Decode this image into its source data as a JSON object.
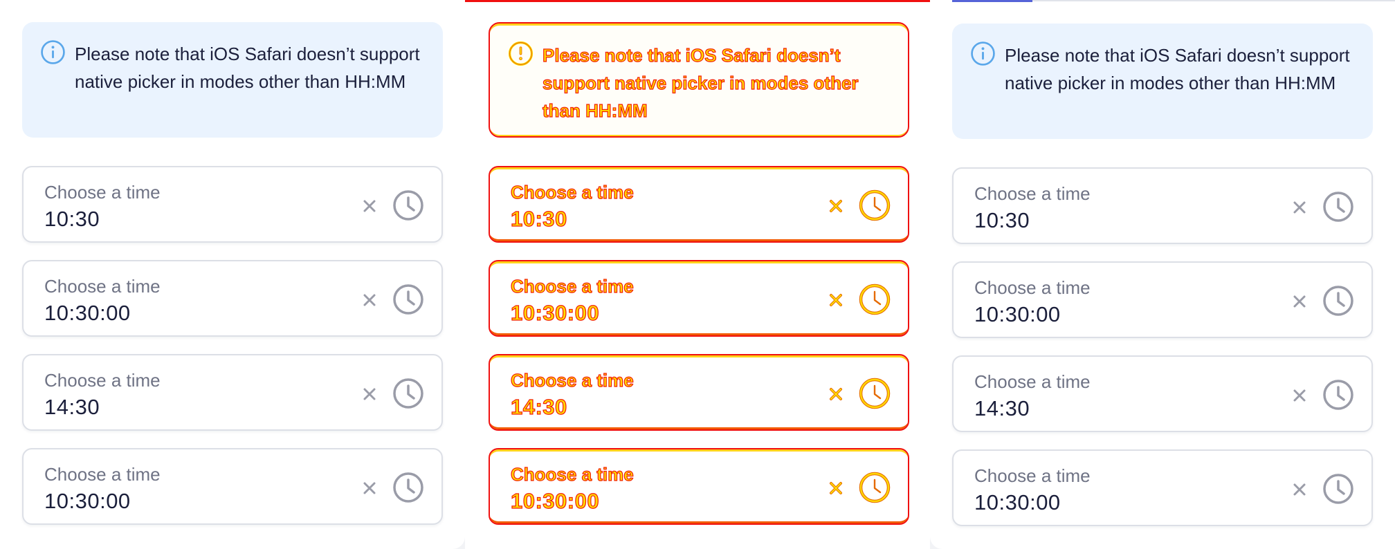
{
  "notice": {
    "text": "Please note that iOS Safari doesn’t support native picker in modes other than HH:MM"
  },
  "field_label": "Choose a time",
  "fields": [
    {
      "label": "Choose a time",
      "value": "10:30"
    },
    {
      "label": "Choose a time",
      "value": "10:30:00"
    },
    {
      "label": "Choose a time",
      "value": "14:30"
    },
    {
      "label": "Choose a time",
      "value": "10:30:00"
    }
  ],
  "icons": {
    "info": "info-icon",
    "clear": "close-icon",
    "clock": "clock-icon"
  },
  "colors": {
    "notice_background": "#eaf3fe",
    "info_icon": "#5aa7ea",
    "text_primary": "#1b1f3b",
    "text_secondary": "#6f7385",
    "field_border": "#dcdfe6",
    "icon_grey": "#9a9ca8",
    "outline_red": "#f01010",
    "outline_yellow": "#ffd800",
    "tab_indicator_blue": "#5563d8"
  }
}
